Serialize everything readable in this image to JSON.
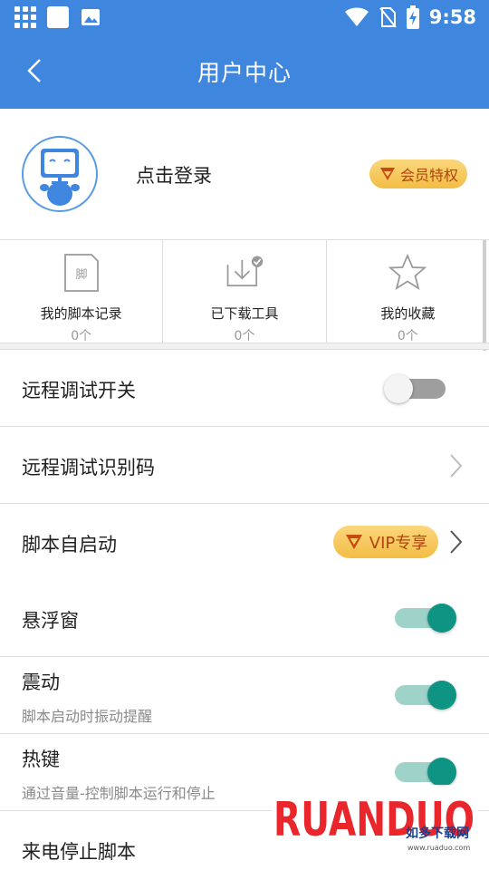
{
  "status_bar": {
    "time": "9:58"
  },
  "app_bar": {
    "title": "用户中心"
  },
  "profile": {
    "login_text": "点击登录",
    "vip_badge": "会员特权"
  },
  "quick_items": [
    {
      "label": "我的脚本记录",
      "count": "0个",
      "icon_text": "脚"
    },
    {
      "label": "已下载工具",
      "count": "0个"
    },
    {
      "label": "我的收藏",
      "count": "0个"
    }
  ],
  "settings": {
    "remote_debug_switch": {
      "label": "远程调试开关",
      "enabled": false
    },
    "remote_debug_code": {
      "label": "远程调试识别码"
    },
    "script_autostart": {
      "label": "脚本自启动",
      "vip_pill": "VIP专享"
    },
    "floating_window": {
      "label": "悬浮窗",
      "enabled": true
    },
    "vibration": {
      "label": "震动",
      "sub": "脚本启动时振动提醒",
      "enabled": true
    },
    "hotkey": {
      "label": "热键",
      "sub": "通过音量-控制脚本运行和停止",
      "enabled": true
    },
    "call_stop": {
      "label": "来电停止脚本"
    }
  },
  "watermark": {
    "brand": "RUANDUO",
    "chinese": "如多下载网",
    "url": "www.ruaduo.com"
  },
  "colors": {
    "primary": "#3f86de",
    "toggle_on": "#0f9484",
    "toggle_track_on": "#9fd3c9",
    "vip_gold": "#f2bd45",
    "vip_text": "#b0450e"
  }
}
